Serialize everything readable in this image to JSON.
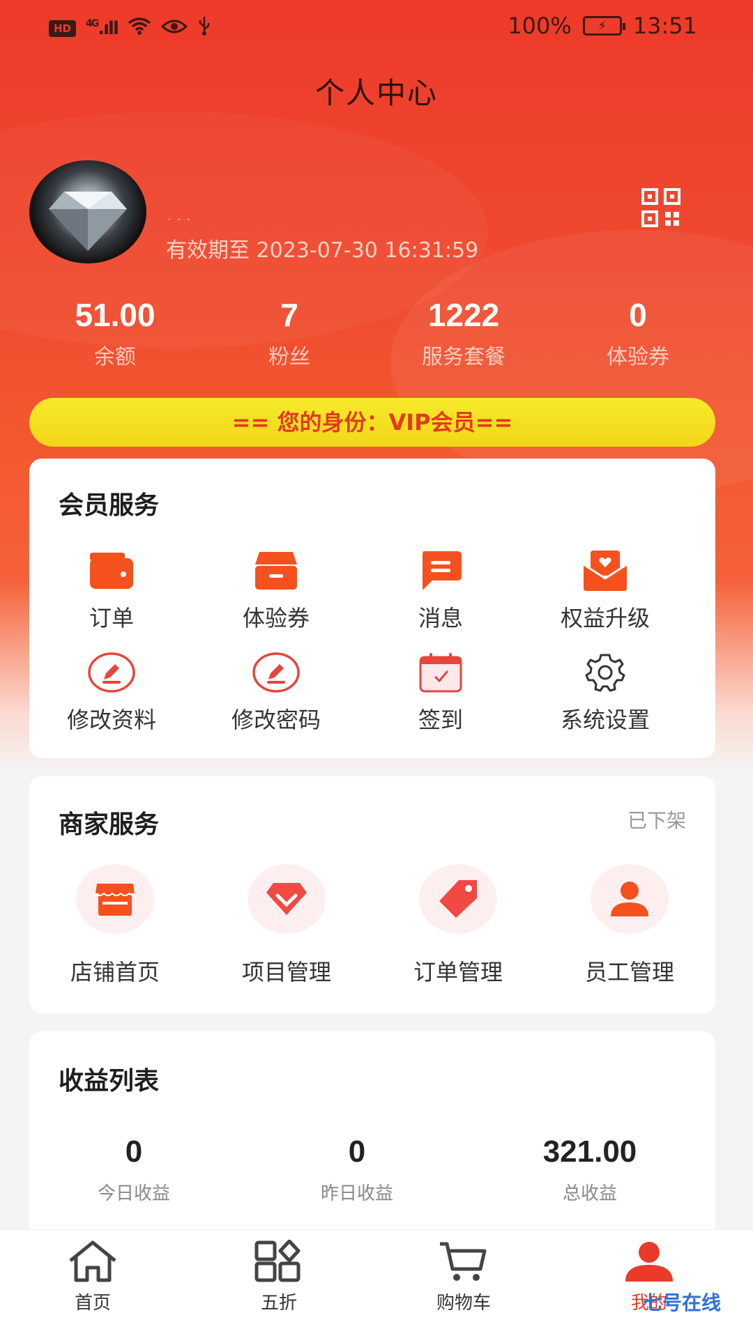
{
  "status_bar": {
    "network": "4G",
    "battery": "100%",
    "time": "13:51"
  },
  "page_title": "个人中心",
  "profile": {
    "username": "...",
    "validity": "有效期至 2023-07-30 16:31:59"
  },
  "stats": [
    {
      "value": "51.00",
      "label": "余额"
    },
    {
      "value": "7",
      "label": "粉丝"
    },
    {
      "value": "1222",
      "label": "服务套餐"
    },
    {
      "value": "0",
      "label": "体验券"
    }
  ],
  "vip_banner": "== 您的身份：VIP会员==",
  "member_services": {
    "title": "会员服务",
    "items": [
      {
        "label": "订单",
        "icon": "wallet-icon"
      },
      {
        "label": "体验券",
        "icon": "box-icon"
      },
      {
        "label": "消息",
        "icon": "message-icon"
      },
      {
        "label": "权益升级",
        "icon": "envelope-heart-icon"
      },
      {
        "label": "修改资料",
        "icon": "edit-profile-icon"
      },
      {
        "label": "修改密码",
        "icon": "edit-password-icon"
      },
      {
        "label": "签到",
        "icon": "calendar-check-icon"
      },
      {
        "label": "系统设置",
        "icon": "gear-icon"
      }
    ]
  },
  "merchant_services": {
    "title": "商家服务",
    "status": "已下架",
    "items": [
      {
        "label": "店铺首页",
        "icon": "store-icon"
      },
      {
        "label": "项目管理",
        "icon": "diamond-icon"
      },
      {
        "label": "订单管理",
        "icon": "tag-icon"
      },
      {
        "label": "员工管理",
        "icon": "person-icon"
      }
    ]
  },
  "earnings": {
    "title": "收益列表",
    "items": [
      {
        "value": "0",
        "label": "今日收益"
      },
      {
        "value": "0",
        "label": "昨日收益"
      },
      {
        "value": "321.00",
        "label": "总收益"
      }
    ]
  },
  "bottom_nav": [
    {
      "label": "首页",
      "icon": "home-icon"
    },
    {
      "label": "五折",
      "icon": "apps-icon"
    },
    {
      "label": "购物车",
      "icon": "cart-icon"
    },
    {
      "label": "我的",
      "icon": "user-icon",
      "active": true
    }
  ],
  "watermark": "七号在线",
  "colors": {
    "primary": "#ee3a2a",
    "vip_yellow": "#f5e123",
    "icon_orange": "#f4511e"
  }
}
